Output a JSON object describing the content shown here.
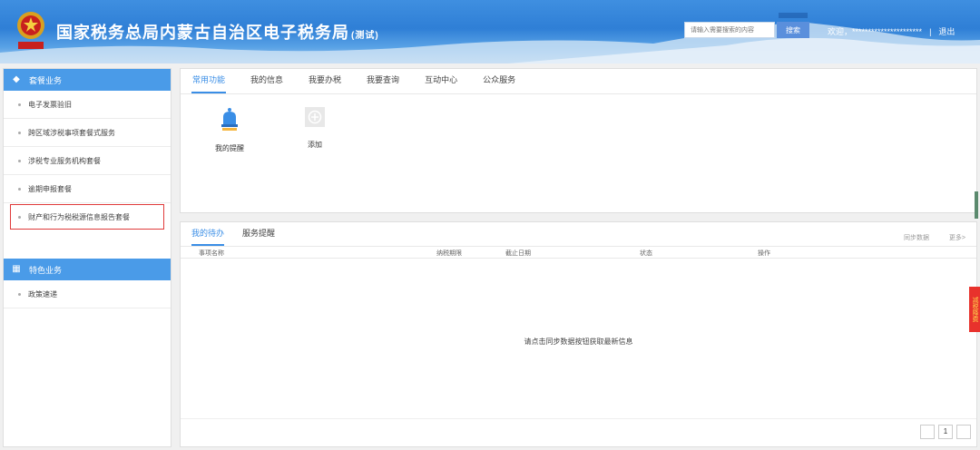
{
  "header": {
    "title": "国家税务总局内蒙古自治区电子税务局",
    "title_suffix": "(测试)",
    "search_placeholder": "请输入需要搜索的内容",
    "search_button": "搜索",
    "welcome": "欢迎，**********************",
    "separator": "|",
    "logout": "退出"
  },
  "sidebar": {
    "section1": {
      "title": "套餐业务",
      "items": [
        "电子发票验旧",
        "跨区域涉税事项套餐式服务",
        "涉税专业服务机构套餐",
        "逾期申报套餐",
        "财产和行为税税源信息报告套餐"
      ]
    },
    "section2": {
      "title": "特色业务",
      "items": [
        "政策速递"
      ]
    }
  },
  "top_panel": {
    "tabs": [
      "常用功能",
      "我的信息",
      "我要办税",
      "我要查询",
      "互动中心",
      "公众服务"
    ],
    "active_tab": 0,
    "functions": [
      {
        "label": "我的提醒",
        "icon": "bell-icon"
      },
      {
        "label": "添加",
        "icon": "plus-icon"
      }
    ]
  },
  "bottom_panel": {
    "tabs": [
      "我的待办",
      "服务提醒"
    ],
    "sync_label": "同步数据",
    "more_label": "更多>",
    "columns": [
      "事项名称",
      "纳税期限",
      "截止日期",
      "状态",
      "操作"
    ],
    "empty_message": "请点击同步数据按钮获取最新信息",
    "page_number": "1"
  },
  "float_tab": {
    "label": "减税降费"
  },
  "colors": {
    "accent": "#3a8ee6",
    "sidebar_header": "#4a9be8",
    "highlight": "#e03b3b"
  }
}
